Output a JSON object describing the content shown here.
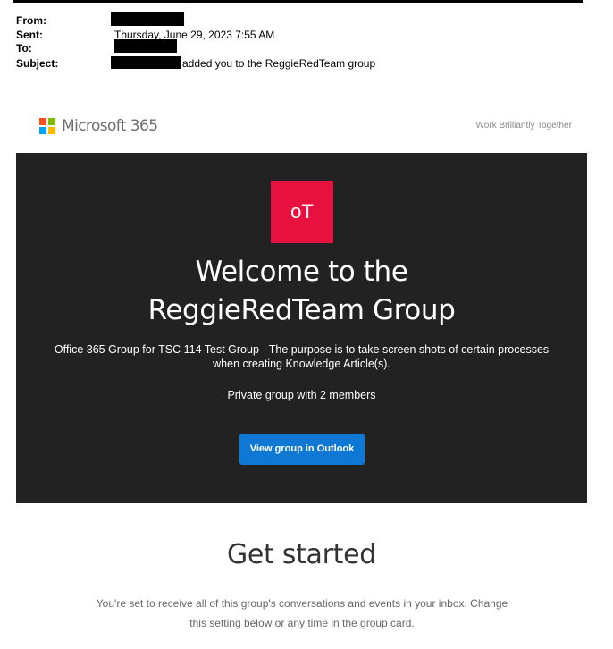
{
  "email_header": {
    "from_label": "From:",
    "sent_label": "Sent:",
    "sent_value": "Thursday, June 29, 2023 7:55 AM",
    "to_label": "To:",
    "subject_label": "Subject:",
    "subject_value": "added you to the ReggieRedTeam group"
  },
  "banner": {
    "logo_icon": "microsoft-logo-icon",
    "brand": "Microsoft 365",
    "tagline": "Work Brilliantly Together",
    "logo_colors": [
      "#f25022",
      "#7fba00",
      "#00a4ef",
      "#ffb900"
    ]
  },
  "hero": {
    "avatar_initials": "oT",
    "avatar_color": "#e8103f",
    "welcome_line1": "Welcome to the",
    "welcome_line2": "ReggieRedTeam Group",
    "description": "Office 365 Group for TSC 114 Test Group - The purpose is to take screen shots of certain processes when creating Knowledge Article(s).",
    "members": "Private group with 2 members",
    "cta_label": "View group in Outlook",
    "cta_color": "#0f78d4",
    "background_color": "#222222"
  },
  "get_started": {
    "title": "Get started",
    "body": "You're set to receive all of this group's conversations and events in your inbox. Change this setting below or any time in the group card."
  }
}
